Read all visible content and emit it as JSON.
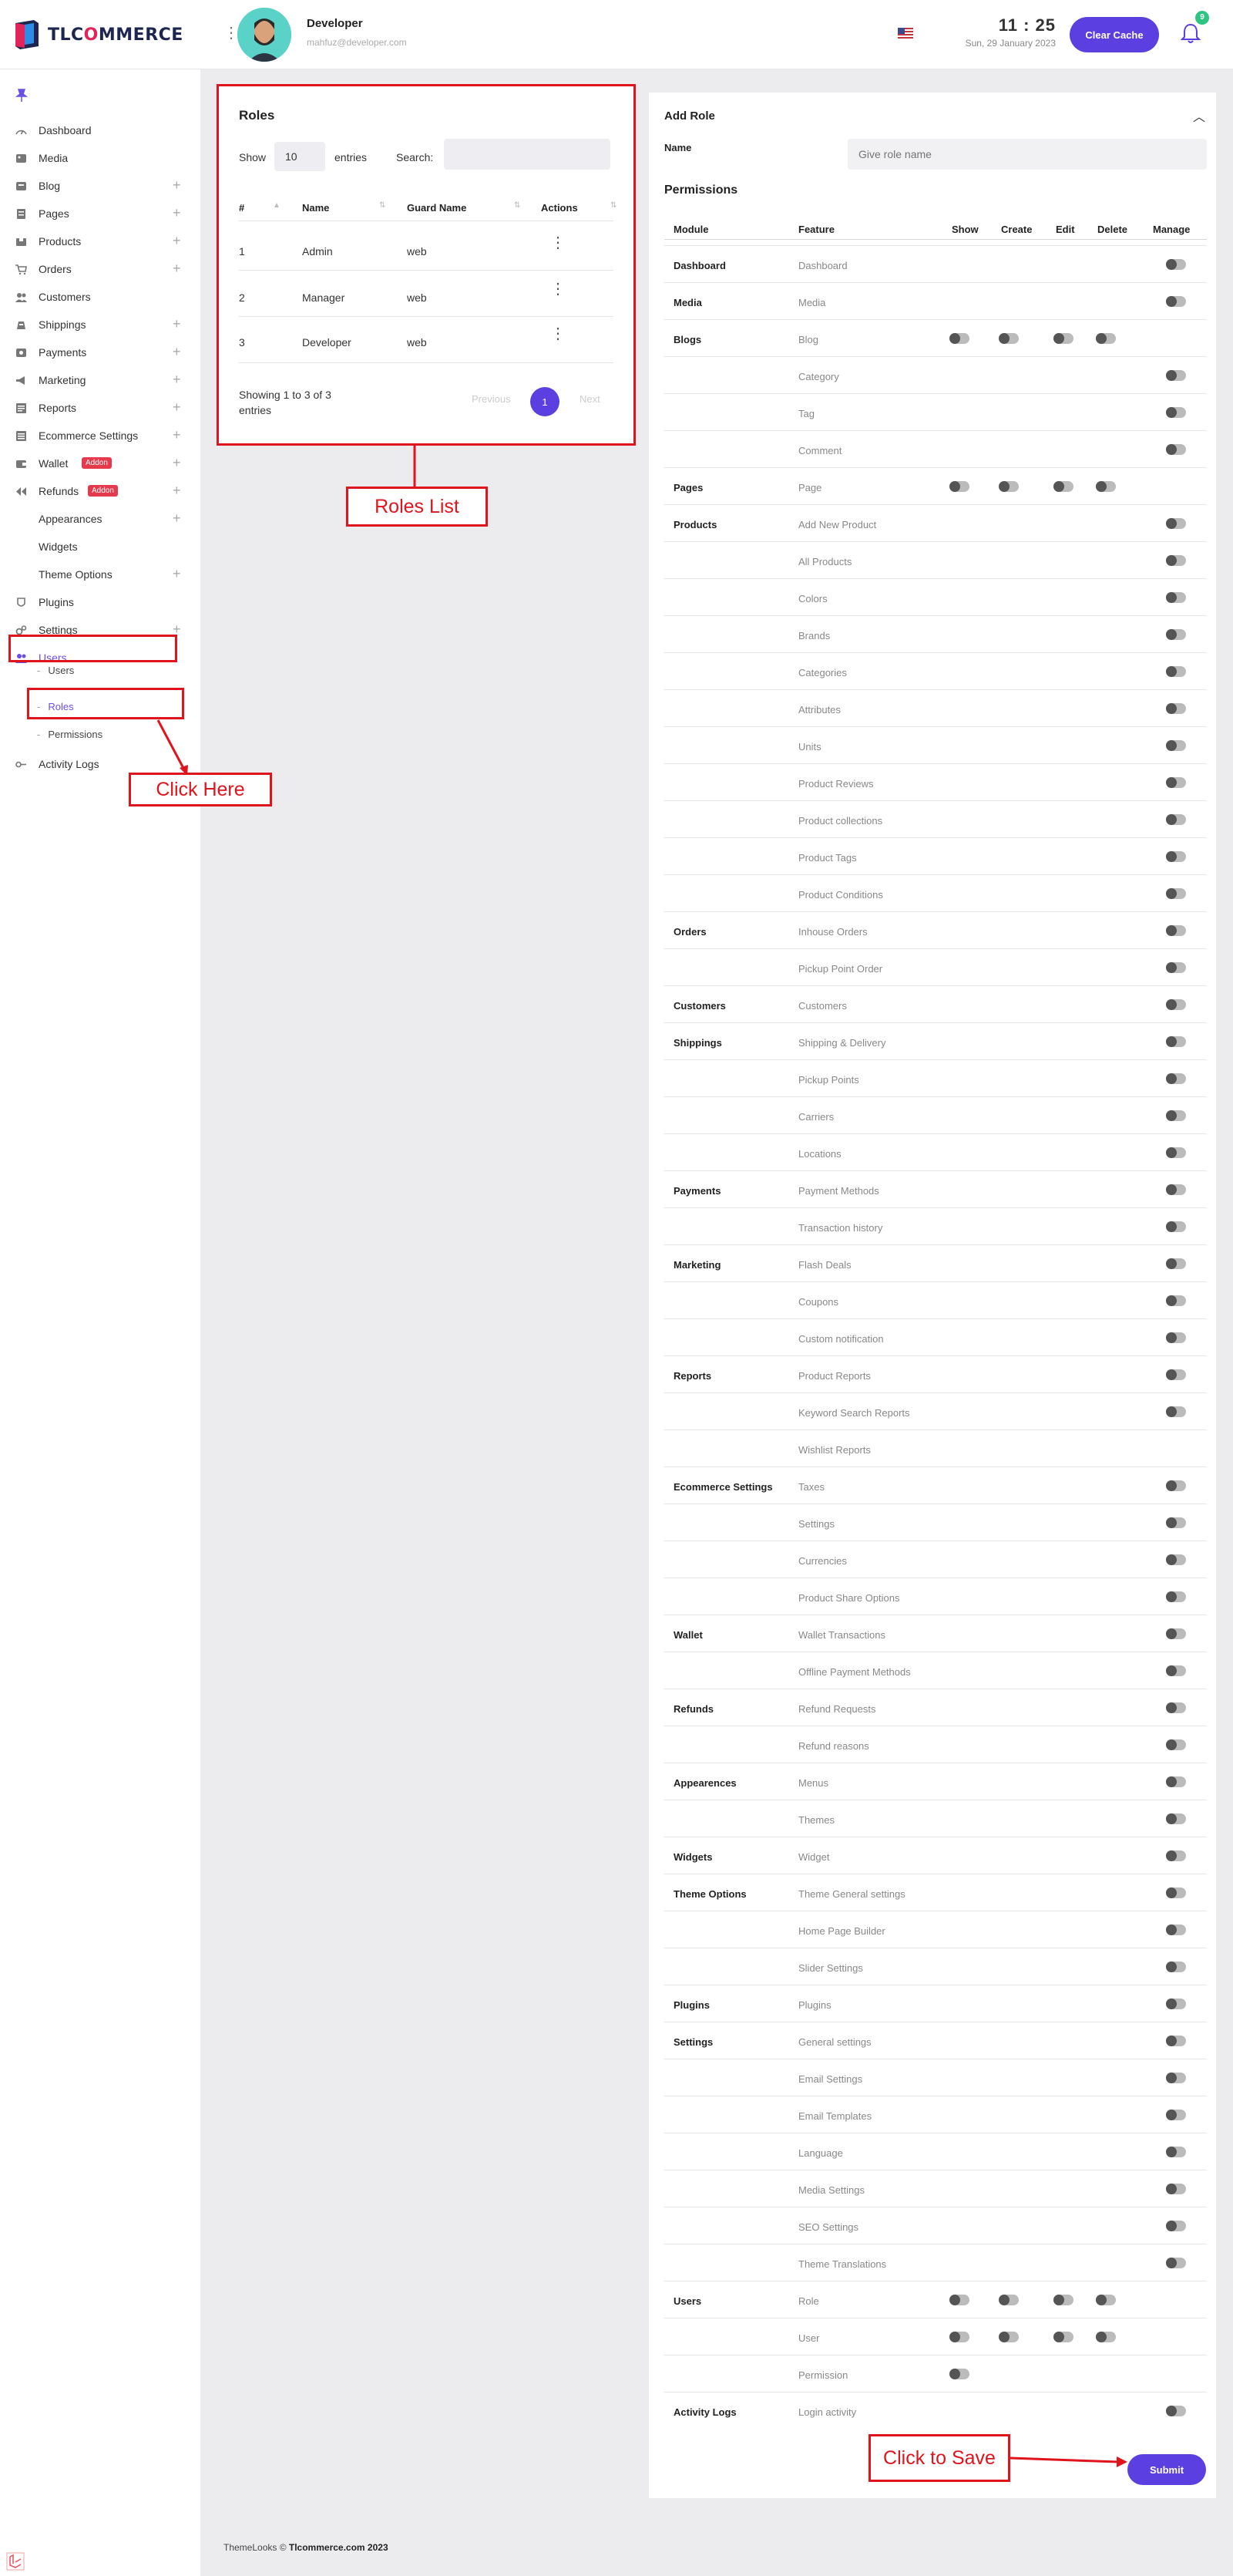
{
  "brand": {
    "name_part1": "TLC",
    "name_o": "O",
    "name_part2": "MMERCE"
  },
  "user": {
    "name": "Developer",
    "email": "mahfuz@developer.com"
  },
  "clock": {
    "time": "11 : 25",
    "date": "Sun, 29 January 2023"
  },
  "header": {
    "clear_cache": "Clear Cache",
    "notification_count": "9"
  },
  "sidebar": {
    "items": [
      {
        "label": "Dashboard",
        "icon": "speedometer-icon",
        "plus": false
      },
      {
        "label": "Media",
        "icon": "image-icon",
        "plus": false
      },
      {
        "label": "Blog",
        "icon": "blog-icon",
        "plus": true
      },
      {
        "label": "Pages",
        "icon": "page-icon",
        "plus": true
      },
      {
        "label": "Products",
        "icon": "box-icon",
        "plus": true
      },
      {
        "label": "Orders",
        "icon": "cart-icon",
        "plus": true
      },
      {
        "label": "Customers",
        "icon": "customers-icon",
        "plus": false
      },
      {
        "label": "Shippings",
        "icon": "truck-icon",
        "plus": true
      },
      {
        "label": "Payments",
        "icon": "wallet-card-icon",
        "plus": true
      },
      {
        "label": "Marketing",
        "icon": "megaphone-icon",
        "plus": true
      },
      {
        "label": "Reports",
        "icon": "report-icon",
        "plus": true
      },
      {
        "label": "Ecommerce Settings",
        "icon": "settings-list-icon",
        "plus": true
      },
      {
        "label": "Wallet",
        "icon": "wallet-icon",
        "plus": true,
        "badge": "Addon"
      },
      {
        "label": "Refunds",
        "icon": "refund-icon",
        "plus": true,
        "badge": "Addon"
      },
      {
        "label": "Appearances",
        "icon": "",
        "plus": true
      },
      {
        "label": "Widgets",
        "icon": "",
        "plus": false
      },
      {
        "label": "Theme Options",
        "icon": "",
        "plus": true
      },
      {
        "label": "Plugins",
        "icon": "plugin-icon",
        "plus": false
      },
      {
        "label": "Settings",
        "icon": "gears-icon",
        "plus": true
      },
      {
        "label": "Users",
        "icon": "users-icon",
        "plus": false
      }
    ],
    "users_sub": [
      "Users",
      "Roles",
      "Permissions"
    ],
    "activity_logs": "Activity Logs"
  },
  "roles": {
    "title": "Roles",
    "show_label": "Show",
    "entries_value": "10",
    "entries_label": "entries",
    "search_label": "Search:",
    "columns": [
      "#",
      "Name",
      "Guard Name",
      "Actions"
    ],
    "rows": [
      {
        "id": "1",
        "name": "Admin",
        "guard": "web"
      },
      {
        "id": "2",
        "name": "Manager",
        "guard": "web"
      },
      {
        "id": "3",
        "name": "Developer",
        "guard": "web"
      }
    ],
    "showing": "Showing 1 to 3 of 3 entries",
    "prev": "Previous",
    "page": "1",
    "next": "Next"
  },
  "add_role": {
    "title": "Add Role",
    "name_label": "Name",
    "name_placeholder": "Give role name",
    "permissions_label": "Permissions",
    "columns": [
      "Module",
      "Feature",
      "Show",
      "Create",
      "Edit",
      "Delete",
      "Manage"
    ],
    "rows": [
      {
        "module": "Dashboard",
        "feature": "Dashboard",
        "toggles": "m"
      },
      {
        "module": "Media",
        "feature": "Media",
        "toggles": "m"
      },
      {
        "module": "Blogs",
        "feature": "Blog",
        "toggles": "scED"
      },
      {
        "module": "",
        "feature": "Category",
        "toggles": "m"
      },
      {
        "module": "",
        "feature": "Tag",
        "toggles": "m"
      },
      {
        "module": "",
        "feature": "Comment",
        "toggles": "m"
      },
      {
        "module": "Pages",
        "feature": "Page",
        "toggles": "scED"
      },
      {
        "module": "Products",
        "feature": "Add New Product",
        "toggles": "m"
      },
      {
        "module": "",
        "feature": "All Products",
        "toggles": "m"
      },
      {
        "module": "",
        "feature": "Colors",
        "toggles": "m"
      },
      {
        "module": "",
        "feature": "Brands",
        "toggles": "m"
      },
      {
        "module": "",
        "feature": "Categories",
        "toggles": "m"
      },
      {
        "module": "",
        "feature": "Attributes",
        "toggles": "m"
      },
      {
        "module": "",
        "feature": "Units",
        "toggles": "m"
      },
      {
        "module": "",
        "feature": "Product Reviews",
        "toggles": "m"
      },
      {
        "module": "",
        "feature": "Product collections",
        "toggles": "m"
      },
      {
        "module": "",
        "feature": "Product Tags",
        "toggles": "m"
      },
      {
        "module": "",
        "feature": "Product Conditions",
        "toggles": "m"
      },
      {
        "module": "Orders",
        "feature": "Inhouse Orders",
        "toggles": "m"
      },
      {
        "module": "",
        "feature": "Pickup Point Order",
        "toggles": "m"
      },
      {
        "module": "Customers",
        "feature": "Customers",
        "toggles": "m"
      },
      {
        "module": "Shippings",
        "feature": "Shipping & Delivery",
        "toggles": "m"
      },
      {
        "module": "",
        "feature": "Pickup Points",
        "toggles": "m"
      },
      {
        "module": "",
        "feature": "Carriers",
        "toggles": "m"
      },
      {
        "module": "",
        "feature": "Locations",
        "toggles": "m"
      },
      {
        "module": "Payments",
        "feature": "Payment Methods",
        "toggles": "m"
      },
      {
        "module": "",
        "feature": "Transaction history",
        "toggles": "m"
      },
      {
        "module": "Marketing",
        "feature": "Flash Deals",
        "toggles": "m"
      },
      {
        "module": "",
        "feature": "Coupons",
        "toggles": "m"
      },
      {
        "module": "",
        "feature": "Custom notification",
        "toggles": "m"
      },
      {
        "module": "Reports",
        "feature": "Product Reports",
        "toggles": "m"
      },
      {
        "module": "",
        "feature": "Keyword Search Reports",
        "toggles": "m"
      },
      {
        "module": "",
        "feature": "Wishlist Reports",
        "toggles": ""
      },
      {
        "module": "Ecommerce Settings",
        "feature": "Taxes",
        "toggles": "m"
      },
      {
        "module": "",
        "feature": "Settings",
        "toggles": "m"
      },
      {
        "module": "",
        "feature": "Currencies",
        "toggles": "m"
      },
      {
        "module": "",
        "feature": "Product Share Options",
        "toggles": "m"
      },
      {
        "module": "Wallet",
        "feature": "Wallet Transactions",
        "toggles": "m"
      },
      {
        "module": "",
        "feature": "Offline Payment Methods",
        "toggles": "m"
      },
      {
        "module": "Refunds",
        "feature": "Refund Requests",
        "toggles": "m"
      },
      {
        "module": "",
        "feature": "Refund reasons",
        "toggles": "m"
      },
      {
        "module": "Appearences",
        "feature": "Menus",
        "toggles": "m"
      },
      {
        "module": "",
        "feature": "Themes",
        "toggles": "m"
      },
      {
        "module": "Widgets",
        "feature": "Widget",
        "toggles": "m"
      },
      {
        "module": "Theme Options",
        "feature": "Theme General settings",
        "toggles": "m"
      },
      {
        "module": "",
        "feature": "Home Page Builder",
        "toggles": "m"
      },
      {
        "module": "",
        "feature": "Slider Settings",
        "toggles": "m"
      },
      {
        "module": "Plugins",
        "feature": "Plugins",
        "toggles": "m"
      },
      {
        "module": "Settings",
        "feature": "General settings",
        "toggles": "m"
      },
      {
        "module": "",
        "feature": "Email Settings",
        "toggles": "m"
      },
      {
        "module": "",
        "feature": "Email Templates",
        "toggles": "m"
      },
      {
        "module": "",
        "feature": "Language",
        "toggles": "m"
      },
      {
        "module": "",
        "feature": "Media Settings",
        "toggles": "m"
      },
      {
        "module": "",
        "feature": "SEO Settings",
        "toggles": "m"
      },
      {
        "module": "",
        "feature": "Theme Translations",
        "toggles": "m"
      },
      {
        "module": "Users",
        "feature": "Role",
        "toggles": "scED"
      },
      {
        "module": "",
        "feature": "User",
        "toggles": "scED"
      },
      {
        "module": "",
        "feature": "Permission",
        "toggles": "s"
      },
      {
        "module": "Activity Logs",
        "feature": "Login activity",
        "toggles": "m"
      }
    ],
    "submit": "Submit"
  },
  "annotations": {
    "roles_list": "Roles List",
    "click_here": "Click Here",
    "click_to_save": "Click to Save"
  },
  "footer": {
    "prefix": "ThemeLooks ©",
    "brand": "Tlcommerce.com 2023"
  },
  "colors": {
    "accent": "#5b3fe0",
    "annotation": "#e0141c",
    "addon_badge": "#e43a4c",
    "bell_badge": "#2ec484"
  }
}
